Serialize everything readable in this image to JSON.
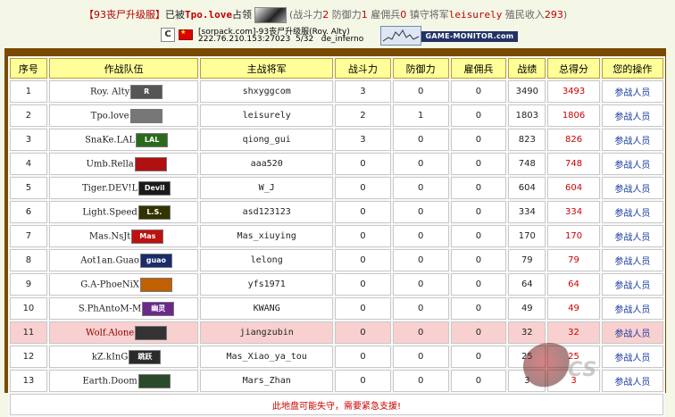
{
  "header": {
    "bracket_open": "【",
    "server_name": "93丧尸升级服",
    "bracket_close": "】",
    "occupied_prefix": "已被",
    "owner": "Tpo.love",
    "occupied_suffix": "占领",
    "stat_atk_label": "(战斗力",
    "stat_atk": "2",
    "stat_def_label": " 防御力",
    "stat_def": "1",
    "stat_merc_label": " 雇佣兵",
    "stat_merc": "0",
    "stat_gen_label": " 镇守将军",
    "stat_gen": "leisurely",
    "stat_income_label": " 殖民收入",
    "stat_income": "293",
    "stat_close": ")"
  },
  "server_banner": {
    "cs_icon": "cs-game-icon",
    "flag_icon": "china-flag-icon",
    "name": "[sorpack.com]-93丧尸升级服(Roy. Alty)",
    "address": "222.76.210.153:27023",
    "players": "5/32",
    "map": "de_inferno",
    "graph_icon": "player-graph-icon",
    "monitor_label": "GAME-MONITOR.com"
  },
  "table": {
    "headers": [
      "序号",
      "作战队伍",
      "主战将军",
      "战斗力",
      "防御力",
      "雇佣兵",
      "战绩",
      "总得分",
      "您的操作"
    ],
    "rows": [
      {
        "no": "1",
        "team": "Roy. Alty",
        "logo": "R",
        "logo_color": "#555555",
        "general": "shxyggcom",
        "atk": "3",
        "def": "0",
        "merc": "0",
        "record": "3490",
        "total": "3493",
        "action": "参战人员"
      },
      {
        "no": "2",
        "team": "Tpo.love",
        "logo": "",
        "logo_color": "#777777",
        "general": "leisurely",
        "atk": "2",
        "def": "1",
        "merc": "0",
        "record": "1803",
        "total": "1806",
        "action": "参战人员"
      },
      {
        "no": "3",
        "team": "SnaKe.LAL",
        "logo": "LAL",
        "logo_color": "#2a6a1a",
        "general": "qiong_gui",
        "atk": "3",
        "def": "0",
        "merc": "0",
        "record": "823",
        "total": "826",
        "action": "参战人员"
      },
      {
        "no": "4",
        "team": "Umb.Rella",
        "logo": "",
        "logo_color": "#b01010",
        "general": "aaa520",
        "atk": "0",
        "def": "0",
        "merc": "0",
        "record": "748",
        "total": "748",
        "action": "参战人员"
      },
      {
        "no": "5",
        "team": "Tiger.DEV!L",
        "logo": "Devil",
        "logo_color": "#1a1a1a",
        "general": "W_J",
        "atk": "0",
        "def": "0",
        "merc": "0",
        "record": "604",
        "total": "604",
        "action": "参战人员"
      },
      {
        "no": "6",
        "team": "Light.Speed",
        "logo": "L.S.",
        "logo_color": "#333300",
        "general": "asd123123",
        "atk": "0",
        "def": "0",
        "merc": "0",
        "record": "334",
        "total": "334",
        "action": "参战人员"
      },
      {
        "no": "7",
        "team": "Mas.NsJt",
        "logo": "Mas",
        "logo_color": "#c01010",
        "general": "Mas_xiuying",
        "atk": "0",
        "def": "0",
        "merc": "0",
        "record": "170",
        "total": "170",
        "action": "参战人员"
      },
      {
        "no": "8",
        "team": "Aot1an.Guao",
        "logo": "guao",
        "logo_color": "#1a2a6a",
        "general": "lelong",
        "atk": "0",
        "def": "0",
        "merc": "0",
        "record": "79",
        "total": "79",
        "action": "参战人员"
      },
      {
        "no": "9",
        "team": "G.A-PhoeNiX",
        "logo": "",
        "logo_color": "#c06000",
        "general": "yfs1971",
        "atk": "0",
        "def": "0",
        "merc": "0",
        "record": "64",
        "total": "64",
        "action": "参战人员"
      },
      {
        "no": "10",
        "team": "S.PhAntoM-M",
        "logo": "幽灵",
        "logo_color": "#6a2a8a",
        "general": "KWANG",
        "atk": "0",
        "def": "0",
        "merc": "0",
        "record": "49",
        "total": "49",
        "action": "参战人员"
      },
      {
        "no": "11",
        "team": "Wolf.Alone",
        "logo": "",
        "logo_color": "#333333",
        "general": "jiangzubin",
        "atk": "0",
        "def": "0",
        "merc": "0",
        "record": "32",
        "total": "32",
        "action": "参战人员",
        "highlight": true
      },
      {
        "no": "12",
        "team": "kZ.kInG",
        "logo": "跳跃",
        "logo_color": "#2a2a2a",
        "general": "Mas_Xiao_ya_tou",
        "atk": "0",
        "def": "0",
        "merc": "0",
        "record": "25",
        "total": "25",
        "action": "参战人员"
      },
      {
        "no": "13",
        "team": "Earth.Doom",
        "logo": "",
        "logo_color": "#2a4a2a",
        "general": "Mars_Zhan",
        "atk": "0",
        "def": "0",
        "merc": "0",
        "record": "3",
        "total": "3",
        "action": "参战人员"
      }
    ],
    "footer_warning": "此地盘可能失守，需要紧急支援!"
  },
  "colors": {
    "header_cell_bg": "#ffff99",
    "highlight_row_bg": "#f9d0d0",
    "frame_brown": "#7a4a00",
    "total_red": "#cc0000",
    "action_blue": "#1a3aa0"
  }
}
